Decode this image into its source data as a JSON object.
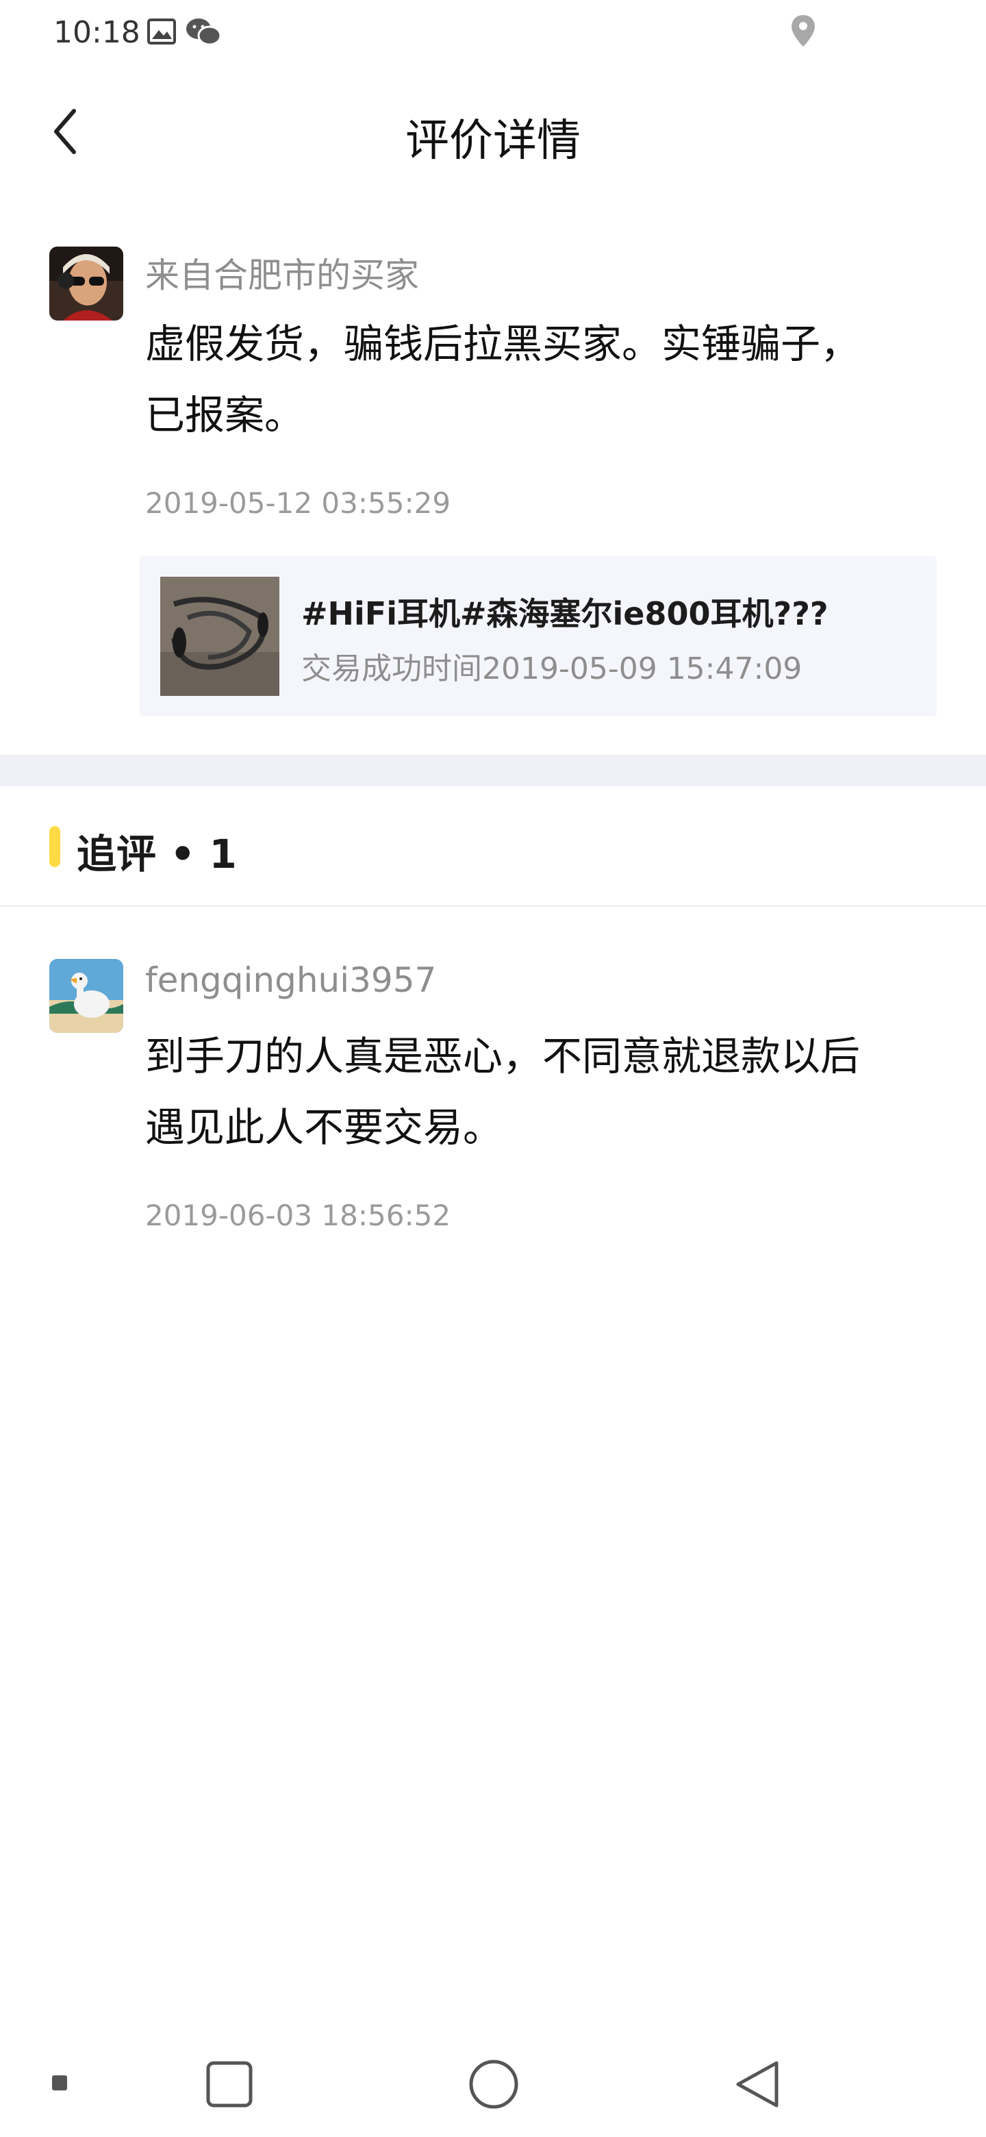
{
  "status_bar": {
    "time": "10:18",
    "icons": [
      "image-icon",
      "wechat-icon",
      "location-icon"
    ]
  },
  "header": {
    "title": "评价详情",
    "back_icon": "chevron-left-icon"
  },
  "review": {
    "user": "来自合肥市的买家",
    "text_line1": "虚假发货，骗钱后拉黑买家。实锤骗子，",
    "text_line2": "已报案。",
    "time": "2019-05-12 03:55:29"
  },
  "item": {
    "title": "#HiFi耳机#森海塞尔ie800耳机???",
    "subtitle": "交易成功时间2019-05-09 15:47:09"
  },
  "followup": {
    "header": "追评 • 1",
    "user": "fengqinghui3957",
    "text_line1": "到手刀的人真是恶心，不同意就退款以后",
    "text_line2": "遇见此人不要交易。",
    "time": "2019-06-03 18:56:52"
  },
  "colors": {
    "accent": "#ffda44",
    "card_bg": "#f5f6fb",
    "band_bg": "#eef0f6"
  }
}
